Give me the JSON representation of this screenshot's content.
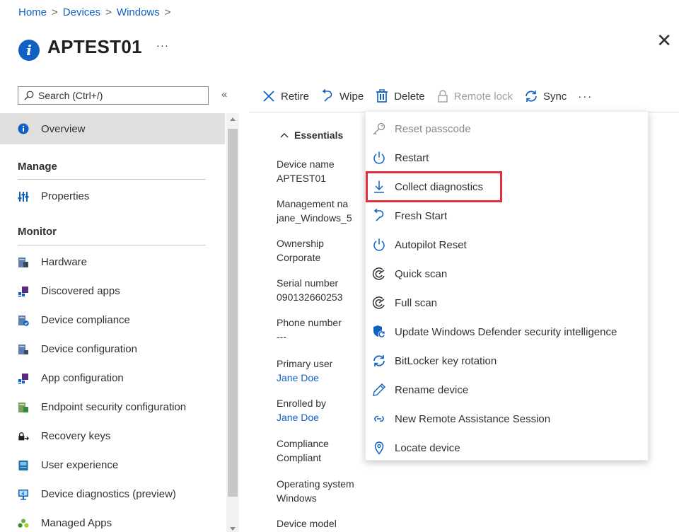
{
  "breadcrumb": [
    {
      "label": "Home"
    },
    {
      "label": "Devices"
    },
    {
      "label": "Windows"
    }
  ],
  "breadcrumb_separator": ">",
  "page": {
    "title": "APTEST01",
    "more_label": "···",
    "close_label": "✕"
  },
  "search": {
    "placeholder": "Search (Ctrl+/)",
    "collapse_label": "«"
  },
  "sidebar": {
    "overview": "Overview",
    "manage_header": "Manage",
    "properties": "Properties",
    "monitor_header": "Monitor",
    "items": [
      "Hardware",
      "Discovered apps",
      "Device compliance",
      "Device configuration",
      "App configuration",
      "Endpoint security configuration",
      "Recovery keys",
      "User experience",
      "Device diagnostics (preview)",
      "Managed Apps"
    ]
  },
  "toolbar": {
    "retire": "Retire",
    "wipe": "Wipe",
    "delete": "Delete",
    "remote_lock": "Remote lock",
    "sync": "Sync",
    "more": "···"
  },
  "essentials": {
    "header": "Essentials",
    "properties": [
      {
        "label": "Device name",
        "value": "APTEST01"
      },
      {
        "label": "Management na",
        "value": "jane_Windows_5"
      },
      {
        "label": "Ownership",
        "value": "Corporate"
      },
      {
        "label": "Serial number",
        "value": "090132660253"
      },
      {
        "label": "Phone number",
        "value": "---"
      },
      {
        "label": "Primary user",
        "value": "Jane Doe"
      },
      {
        "label": "Enrolled by",
        "value": "Jane Doe"
      },
      {
        "label": "Compliance",
        "value": "Compliant"
      },
      {
        "label": "Operating system",
        "value": "Windows"
      },
      {
        "label": "Device model",
        "value": ""
      }
    ]
  },
  "dropdown": {
    "items": [
      "Reset passcode",
      "Restart",
      "Collect diagnostics",
      "Fresh Start",
      "Autopilot Reset",
      "Quick scan",
      "Full scan",
      "Update Windows Defender security intelligence",
      "BitLocker key rotation",
      "Rename device",
      "New Remote Assistance Session",
      "Locate device"
    ]
  },
  "colors": {
    "accent": "#0f62c4",
    "highlight": "#e0313a",
    "selected_bg": "#e1dfdd"
  }
}
